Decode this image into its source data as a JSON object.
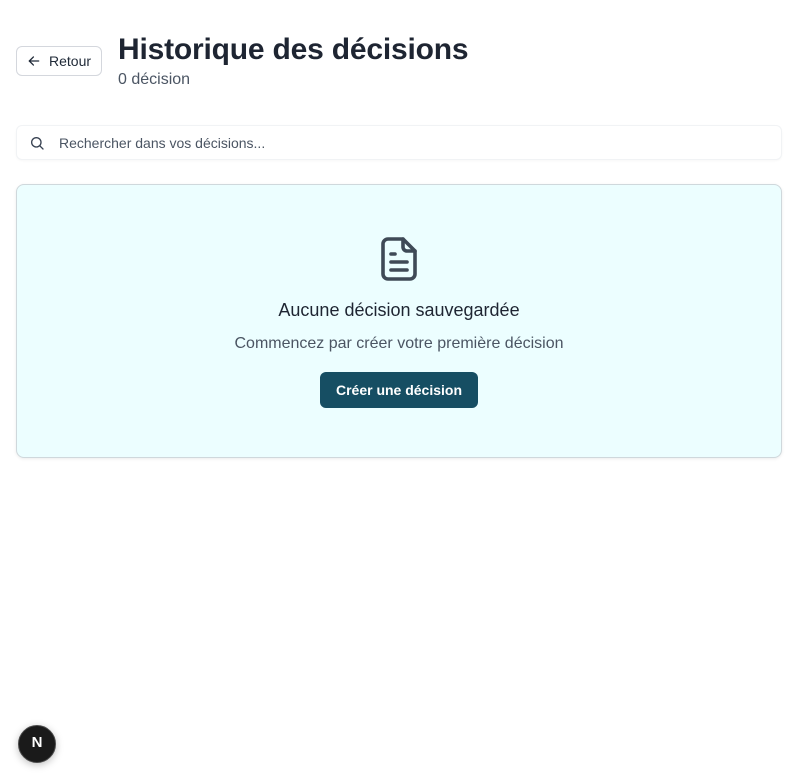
{
  "header": {
    "back_label": "Retour",
    "title": "Historique des décisions",
    "subtitle": "0 décision"
  },
  "search": {
    "placeholder": "Rechercher dans vos décisions...",
    "value": "",
    "icon": "search-icon"
  },
  "empty_state": {
    "icon": "document-icon",
    "title": "Aucune décision sauvegardée",
    "description": "Commencez par créer votre première décision",
    "create_button_label": "Créer une décision"
  },
  "dev_badge": {
    "letter": "N",
    "icon": "nextjs-logo-icon"
  },
  "colors": {
    "primary_button": "#164e63",
    "empty_card_bg": "#ecfeff",
    "title_text": "#1e2532",
    "muted_text": "#4b5563"
  }
}
